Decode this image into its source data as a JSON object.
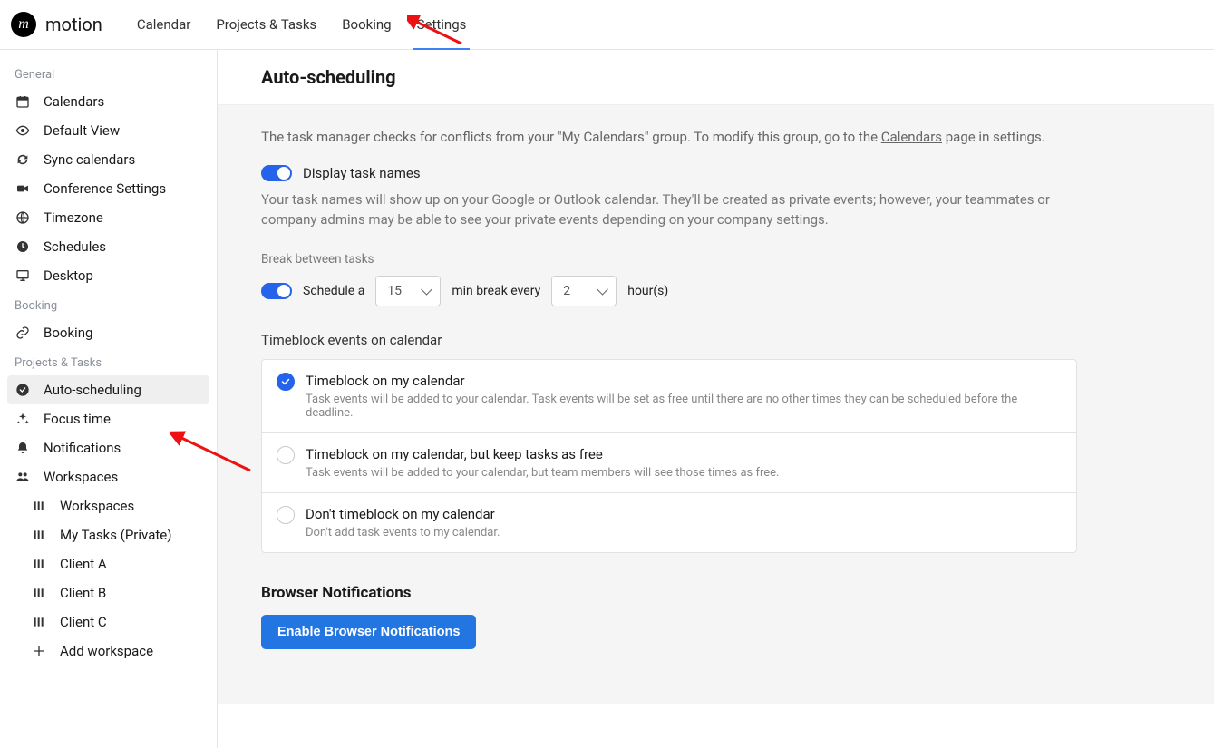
{
  "brand": "motion",
  "topnav": [
    "Calendar",
    "Projects & Tasks",
    "Booking",
    "Settings"
  ],
  "topnav_active": 3,
  "sidebar": {
    "general_label": "General",
    "general": [
      {
        "icon": "calendar",
        "label": "Calendars"
      },
      {
        "icon": "eye",
        "label": "Default View"
      },
      {
        "icon": "sync",
        "label": "Sync calendars"
      },
      {
        "icon": "video",
        "label": "Conference Settings"
      },
      {
        "icon": "globe",
        "label": "Timezone"
      },
      {
        "icon": "clock",
        "label": "Schedules"
      },
      {
        "icon": "desktop",
        "label": "Desktop"
      }
    ],
    "booking_label": "Booking",
    "booking": [
      {
        "icon": "link",
        "label": "Booking"
      }
    ],
    "pt_label": "Projects & Tasks",
    "pt": [
      {
        "icon": "check-circle",
        "label": "Auto-scheduling",
        "active": true
      },
      {
        "icon": "sparkle",
        "label": "Focus time"
      },
      {
        "icon": "bell",
        "label": "Notifications"
      },
      {
        "icon": "people",
        "label": "Workspaces"
      }
    ],
    "workspaces": [
      {
        "icon": "cols",
        "label": "Workspaces"
      },
      {
        "icon": "cols",
        "label": "My Tasks (Private)"
      },
      {
        "icon": "cols",
        "label": "Client A"
      },
      {
        "icon": "cols",
        "label": "Client B"
      },
      {
        "icon": "cols",
        "label": "Client C"
      },
      {
        "icon": "plus",
        "label": "Add workspace"
      }
    ]
  },
  "page": {
    "title": "Auto-scheduling",
    "info_pre": "The task manager checks for conflicts from your \"My Calendars\" group. To modify this group, go to the ",
    "info_link": "Calendars",
    "info_post": " page in settings.",
    "display_task_names_label": "Display task names",
    "display_task_names_desc": "Your task names will show up on your Google or Outlook calendar. They'll be created as private events; however, your teammates or company admins may be able to see your private events depending on your company settings.",
    "break_label": "Break between tasks",
    "schedule_a": "Schedule a",
    "break_minutes": "15",
    "min_break_every": "min break every",
    "break_hours": "2",
    "hours_suffix": "hour(s)",
    "timeblock_label": "Timeblock events on calendar",
    "timeblock_options": [
      {
        "title": "Timeblock on my calendar",
        "desc": "Task events will be added to your calendar. Task events will be set as free until there are no other times they can be scheduled before the deadline.",
        "selected": true
      },
      {
        "title": "Timeblock on my calendar, but keep tasks as free",
        "desc": "Task events will be added to your calendar, but team members will see those times as free.",
        "selected": false
      },
      {
        "title": "Don't timeblock on my calendar",
        "desc": "Don't add task events to my calendar.",
        "selected": false
      }
    ],
    "browser_notif_heading": "Browser Notifications",
    "enable_btn": "Enable Browser Notifications"
  }
}
